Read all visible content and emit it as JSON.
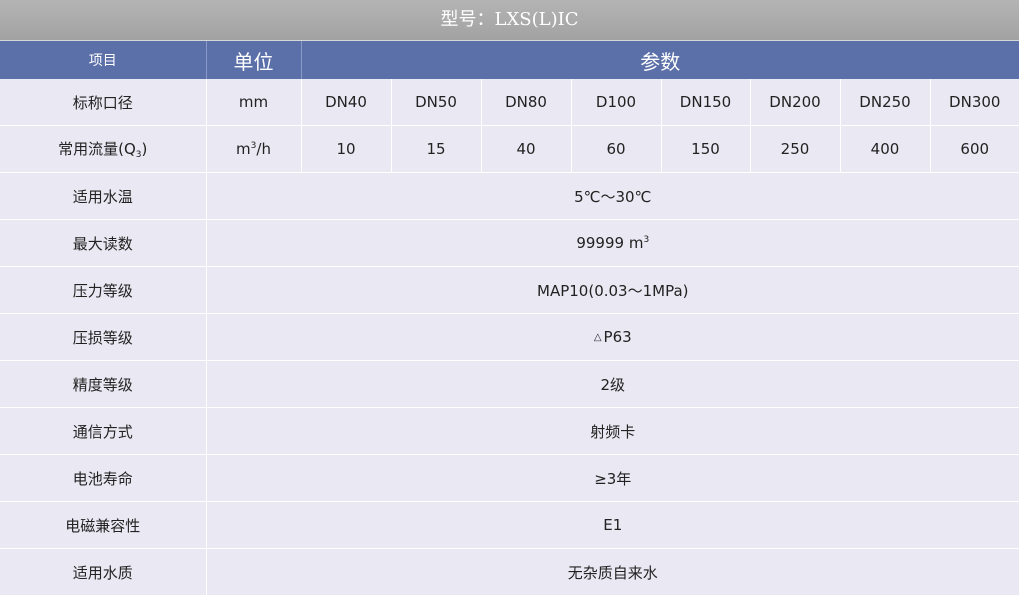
{
  "title": "型号：LXS(L)IC",
  "header": {
    "item": "项目",
    "unit": "单位",
    "params": "参数"
  },
  "nominal_diameter": {
    "label": "标称口径",
    "unit": "mm",
    "values": [
      "DN40",
      "DN50",
      "DN80",
      "D100",
      "DN150",
      "DN200",
      "DN250",
      "DN300"
    ]
  },
  "flow_rate": {
    "label_text": "常用流量(Q",
    "label_sub": "3",
    "label_close": ")",
    "unit_base": "m",
    "unit_sup": "3",
    "unit_tail": "/h",
    "values": [
      "10",
      "15",
      "40",
      "60",
      "150",
      "250",
      "400",
      "600"
    ]
  },
  "rows": {
    "water_temp": {
      "label": "适用水温",
      "value": "5℃～30℃"
    },
    "max_reading": {
      "label": "最大读数",
      "value": "99999 m",
      "value_sup": "3"
    },
    "pressure_class": {
      "label": "压力等级",
      "value": "MAP10(0.03～1MPa)"
    },
    "pressure_loss": {
      "label": "压损等级",
      "value_symbol": "△",
      "value": "P63"
    },
    "accuracy": {
      "label": "精度等级",
      "value": "2级"
    },
    "communication": {
      "label": "通信方式",
      "value": "射频卡"
    },
    "battery_life": {
      "label": "电池寿命",
      "value": "≥3年"
    },
    "emc": {
      "label": "电磁兼容性",
      "value": "E1"
    },
    "water_quality": {
      "label": "适用水质",
      "value": "无杂质自来水"
    }
  }
}
